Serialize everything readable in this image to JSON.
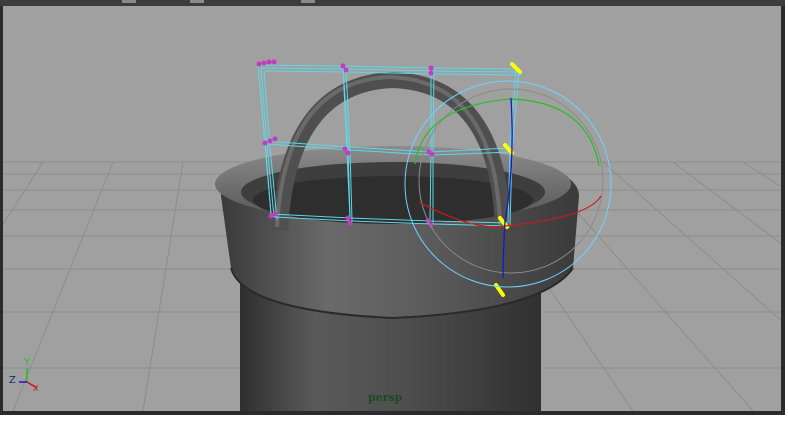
{
  "viewport": {
    "camera_label": "persp",
    "axes": {
      "x": "X",
      "y": "Y",
      "z": "Z"
    }
  },
  "colors": {
    "viewport_bg": "#a0a0a0",
    "grid_line": "#8c8c8c",
    "lattice": "#5fd7e8",
    "lattice_point": "#c23bc2",
    "selected_point": "#ffff00",
    "rotate_x_ring": "#d01818",
    "rotate_y_ring": "#23c023",
    "rotate_z_ring": "#1818c8",
    "rotate_view_ring": "#6fd4ff",
    "model": "#4a4a4a"
  }
}
